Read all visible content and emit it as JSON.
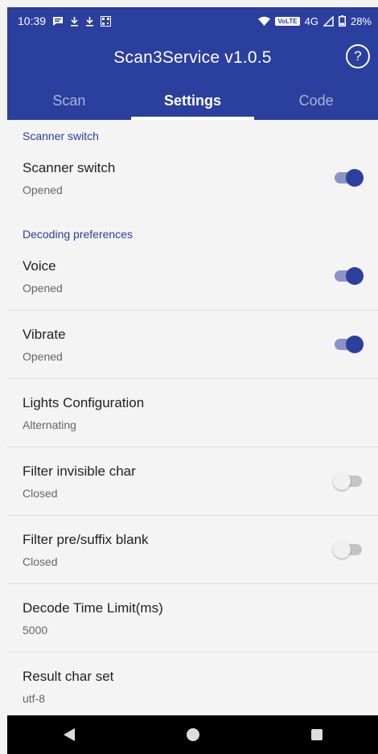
{
  "status": {
    "time": "10:39",
    "network": "4G",
    "volte": "VoLTE",
    "battery": "28%",
    "icons": [
      "message-icon",
      "download-icon",
      "download-icon",
      "qr-icon",
      "wifi-icon",
      "signal-icon",
      "battery-icon"
    ]
  },
  "app": {
    "title": "Scan3Service v1.0.5",
    "help_icon": "help-icon"
  },
  "tabs": [
    {
      "label": "Scan",
      "active": false
    },
    {
      "label": "Settings",
      "active": true
    },
    {
      "label": "Code",
      "active": false
    }
  ],
  "sections": {
    "scanner": {
      "title": "Scanner switch",
      "items": [
        {
          "title": "Scanner switch",
          "summary": "Opened",
          "switch": "on"
        }
      ]
    },
    "decoding": {
      "title": "Decoding preferences",
      "items": [
        {
          "title": "Voice",
          "summary": "Opened",
          "switch": "on"
        },
        {
          "title": "Vibrate",
          "summary": "Opened",
          "switch": "on"
        },
        {
          "title": "Lights Configuration",
          "summary": "Alternating"
        },
        {
          "title": "Filter invisible char",
          "summary": "Closed",
          "switch": "off"
        },
        {
          "title": "Filter pre/suffix blank",
          "summary": "Closed",
          "switch": "off"
        },
        {
          "title": "Decode Time Limit(ms)",
          "summary": "5000"
        },
        {
          "title": "Result char set",
          "summary": "utf-8"
        }
      ]
    }
  },
  "colors": {
    "primary": "#2b3f9e",
    "switch_track_on": "#8b93c9",
    "section_title": "#2b3f9e",
    "background": "#f4f4f4"
  },
  "navbar": {
    "icons": [
      "back-icon",
      "home-icon",
      "recents-icon"
    ]
  }
}
